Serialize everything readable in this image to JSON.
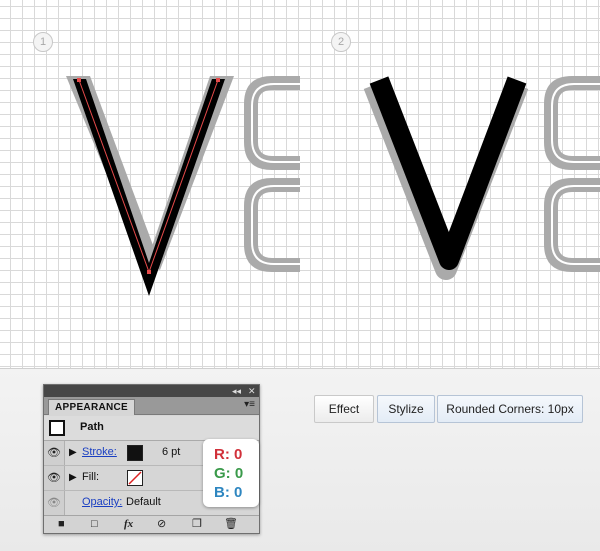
{
  "steps": [
    "1",
    "2"
  ],
  "panel": {
    "tab_label": "APPEARANCE",
    "titlebar_collapse": "◂◂",
    "titlebar_close": "✕",
    "menu_glyph": "▾≡",
    "path_label": "Path",
    "stroke": {
      "label": "Stroke:",
      "weight": "6 pt",
      "color": "#111111"
    },
    "fill": {
      "label": "Fill:",
      "state": "none"
    },
    "opacity": {
      "label": "Opacity:",
      "value": "Default"
    },
    "footer_icons": [
      "new-art-icon",
      "add-stroke-icon",
      "add-effect-icon",
      "clear-appearance-icon",
      "duplicate-item-icon",
      "delete-item-icon"
    ],
    "fx_label": "fx"
  },
  "rgb": {
    "r": "R: 0",
    "g": "G: 0",
    "b": "B: 0",
    "r_color": "#d1303a",
    "g_color": "#3a9a4a",
    "b_color": "#2e86c0"
  },
  "breadcrumbs": [
    "Effect",
    "Stylize",
    "Rounded Corners: 10px"
  ],
  "colors": {
    "path_anchor": "#e64a4a",
    "artwork_black": "#000000",
    "ghost_gray": "#aaaaaa"
  }
}
